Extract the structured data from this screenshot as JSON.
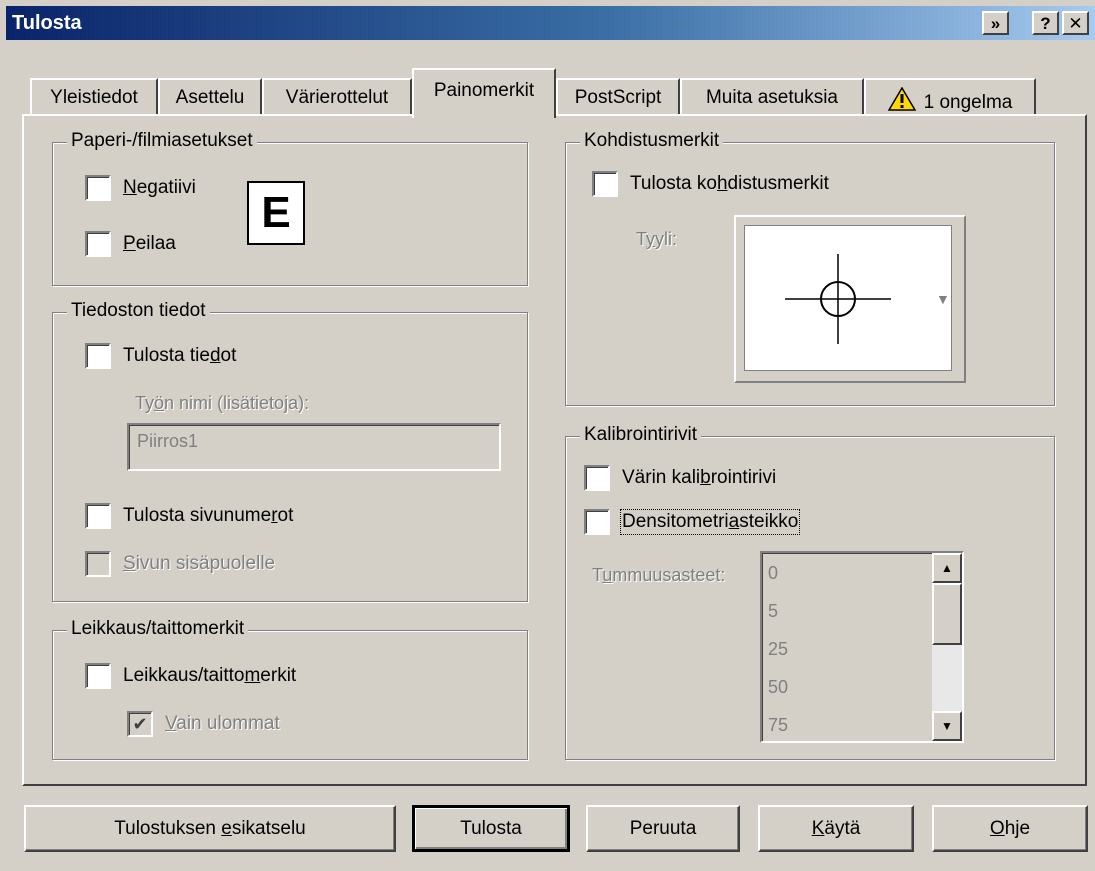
{
  "window": {
    "title": "Tulosta",
    "title_buttons": {
      "options": "»",
      "help": "?",
      "close": "✕"
    }
  },
  "tabs": [
    {
      "label": "Yleistiedot",
      "active": false
    },
    {
      "label": "Asettelu",
      "active": false
    },
    {
      "label": "Värierottelut",
      "active": false
    },
    {
      "label": "Painomerkit",
      "active": true
    },
    {
      "label": "PostScript",
      "active": false
    },
    {
      "label": "Muita asetuksia",
      "active": false
    },
    {
      "label": "1 ongelma",
      "active": false,
      "icon": "warning-icon"
    }
  ],
  "paper": {
    "legend": "Paperi-/filmiasetukset",
    "negative": {
      "pre": "",
      "key": "N",
      "post": "egatiivi",
      "checked": false
    },
    "mirror": {
      "pre": "",
      "key": "P",
      "post": "eilaa",
      "checked": false
    },
    "preview_letter": "E"
  },
  "fileinfo": {
    "legend": "Tiedoston tiedot",
    "print_info": {
      "pre": "Tulosta tie",
      "key": "d",
      "post": "ot",
      "checked": false
    },
    "job_label": {
      "pre": "Ty",
      "key": "ö",
      "post": "n nimi (lisätietoja):"
    },
    "job_value": "Piirros1",
    "page_numbers": {
      "pre": "Tulosta sivunume",
      "key": "r",
      "post": "ot",
      "checked": false
    },
    "inside_page": {
      "pre": "",
      "key": "S",
      "post": "ivun sisäpuolelle",
      "checked": false,
      "enabled": false
    }
  },
  "crop": {
    "legend": "Leikkaus/taittomerkit",
    "crop_marks": {
      "pre": "Leikkaus/taitto",
      "key": "m",
      "post": "erkit",
      "checked": false
    },
    "exterior_only": {
      "pre": "",
      "key": "V",
      "post": "ain ulommat",
      "checked": true,
      "enabled": false
    }
  },
  "registration": {
    "legend": "Kohdistusmerkit",
    "print_reg": {
      "pre": "Tulosta ko",
      "key": "h",
      "post": "distusmerkit",
      "checked": false
    },
    "style_label": {
      "pre": "T",
      "key": "y",
      "post": "yli:"
    }
  },
  "calibration": {
    "legend": "Kalibrointirivit",
    "color_bar": {
      "pre": "Värin kali",
      "key": "b",
      "post": "rointirivi",
      "checked": false
    },
    "densitometer": {
      "pre": "Densitometri",
      "key": "a",
      "post": "steikko",
      "checked": false
    },
    "densities_label": {
      "pre": "T",
      "key": "u",
      "post": "mmuusasteet:"
    },
    "densities": [
      "0",
      "5",
      "25",
      "50",
      "75"
    ]
  },
  "buttons": {
    "preview": {
      "pre": "Tulostuksen ",
      "key": "e",
      "post": "sikatselu"
    },
    "print": {
      "pre": "Tulosta",
      "key": "",
      "post": ""
    },
    "cancel": {
      "pre": "Peruuta",
      "key": "",
      "post": ""
    },
    "apply": {
      "pre": "",
      "key": "K",
      "post": "äytä"
    },
    "help": {
      "pre": "",
      "key": "O",
      "post": "hje"
    }
  },
  "colors": {
    "face": "#d4d0c8",
    "title_start": "#0a246a",
    "title_end": "#a6caf0",
    "warning": "#ffd800"
  }
}
